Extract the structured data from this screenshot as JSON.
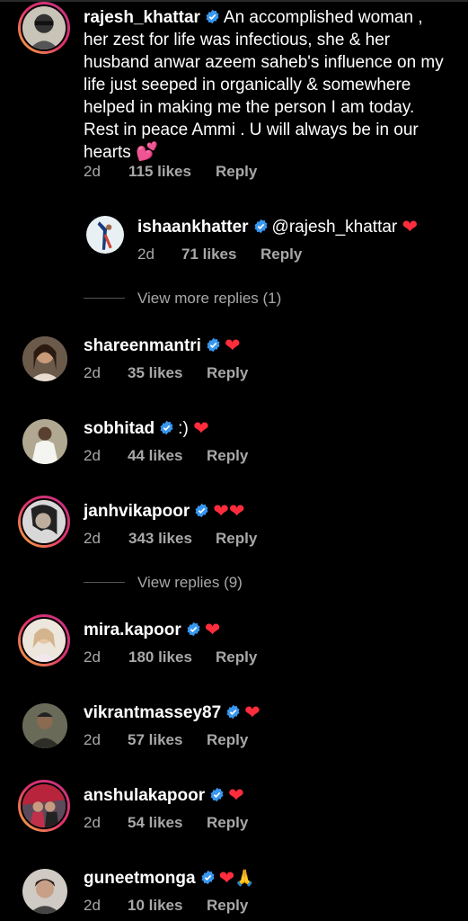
{
  "comments": [
    {
      "username": "rajesh_khattar",
      "text": "An accomplished woman , her zest for life was infectious, she & her husband anwar azeem saheb's influence on my life just seeped in organically & somewhere helped in making me the person I am today. Rest in peace Ammi . U will always be in our hearts",
      "lines": [
        "her zest for life was infectious, she & her",
        "husband anwar azeem saheb's influence on my",
        "life just seeped in organically & somewhere",
        "helped in making me the person I am today.",
        "Rest in peace Ammi . U will always be in our",
        "hearts"
      ],
      "first_line": "An accomplished woman ,",
      "emoji": "💕",
      "time": "2d",
      "likes": "115 likes",
      "reply": "Reply",
      "verified": true,
      "story_ring": true
    },
    {
      "username": "ishaankhatter",
      "text": "@rajesh_khattar",
      "emoji": "❤",
      "time": "2d",
      "likes": "71 likes",
      "reply": "Reply",
      "verified": true,
      "story_ring": false
    },
    {
      "username": "shareenmantri",
      "text": "",
      "emoji": "❤",
      "time": "2d",
      "likes": "35 likes",
      "reply": "Reply",
      "verified": true,
      "story_ring": false
    },
    {
      "username": "sobhitad",
      "text": ":)",
      "emoji": "❤",
      "time": "2d",
      "likes": "44 likes",
      "reply": "Reply",
      "verified": true,
      "story_ring": false
    },
    {
      "username": "janhvikapoor",
      "text": "",
      "emoji": "❤❤",
      "time": "2d",
      "likes": "343 likes",
      "reply": "Reply",
      "verified": true,
      "story_ring": true
    },
    {
      "username": "mira.kapoor",
      "text": "",
      "emoji": "❤",
      "time": "2d",
      "likes": "180 likes",
      "reply": "Reply",
      "verified": true,
      "story_ring": true
    },
    {
      "username": "vikrantmassey87",
      "text": "",
      "emoji": "❤",
      "time": "2d",
      "likes": "57 likes",
      "reply": "Reply",
      "verified": true,
      "story_ring": false
    },
    {
      "username": "anshulakapoor",
      "text": "",
      "emoji": "❤",
      "time": "2d",
      "likes": "54 likes",
      "reply": "Reply",
      "verified": true,
      "story_ring": true
    },
    {
      "username": "guneetmonga",
      "text": "",
      "emoji": "❤",
      "emoji2": "🙏",
      "time": "2d",
      "likes": "10 likes",
      "reply": "Reply",
      "verified": true,
      "story_ring": false
    }
  ],
  "view_more_replies": "View more replies (1)",
  "view_replies": "View replies (9)",
  "colors": {
    "background": "#000000",
    "meta": "#a8a8a8",
    "heart": "#ff2d3c",
    "verified": "#3897f0"
  },
  "icons": {
    "verified": "verified-badge-icon",
    "heart": "red-heart-emoji"
  }
}
